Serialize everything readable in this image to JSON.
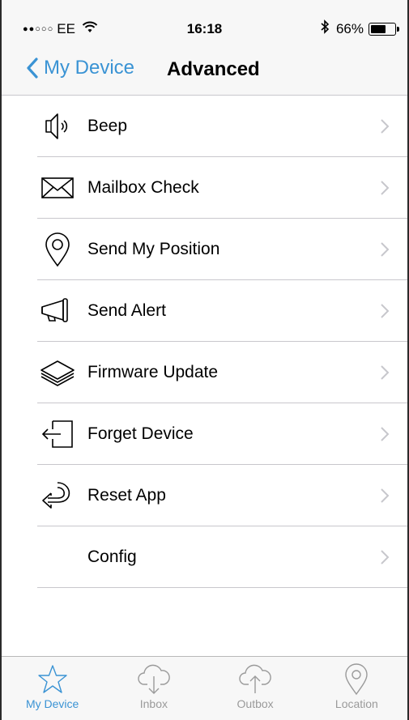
{
  "status_bar": {
    "signal": "●●○○○",
    "carrier": "EE",
    "wifi_icon": "wifi-icon",
    "time": "16:18",
    "bluetooth": "✱",
    "battery_percent": "66%",
    "battery_level": 0.66
  },
  "nav": {
    "back_label": "My Device",
    "title": "Advanced"
  },
  "menu": {
    "items": [
      {
        "label": "Beep",
        "icon": "speaker-icon"
      },
      {
        "label": "Mailbox Check",
        "icon": "envelope-icon"
      },
      {
        "label": "Send My Position",
        "icon": "location-pin-icon"
      },
      {
        "label": "Send Alert",
        "icon": "megaphone-icon"
      },
      {
        "label": "Firmware Update",
        "icon": "layers-icon"
      },
      {
        "label": "Forget Device",
        "icon": "exit-icon"
      },
      {
        "label": "Reset App",
        "icon": "reset-arrow-icon"
      },
      {
        "label": "Config",
        "icon": ""
      }
    ]
  },
  "tabbar": {
    "tabs": [
      {
        "label": "My Device",
        "icon": "star-icon",
        "active": true
      },
      {
        "label": "Inbox",
        "icon": "cloud-download-icon",
        "active": false
      },
      {
        "label": "Outbox",
        "icon": "cloud-upload-icon",
        "active": false
      },
      {
        "label": "Location",
        "icon": "location-pin-icon",
        "active": false
      }
    ]
  },
  "colors": {
    "accent": "#3a93d4",
    "inactive": "#9a9a9a",
    "separator": "#c8c7cc",
    "bar_bg": "#f7f7f7"
  }
}
